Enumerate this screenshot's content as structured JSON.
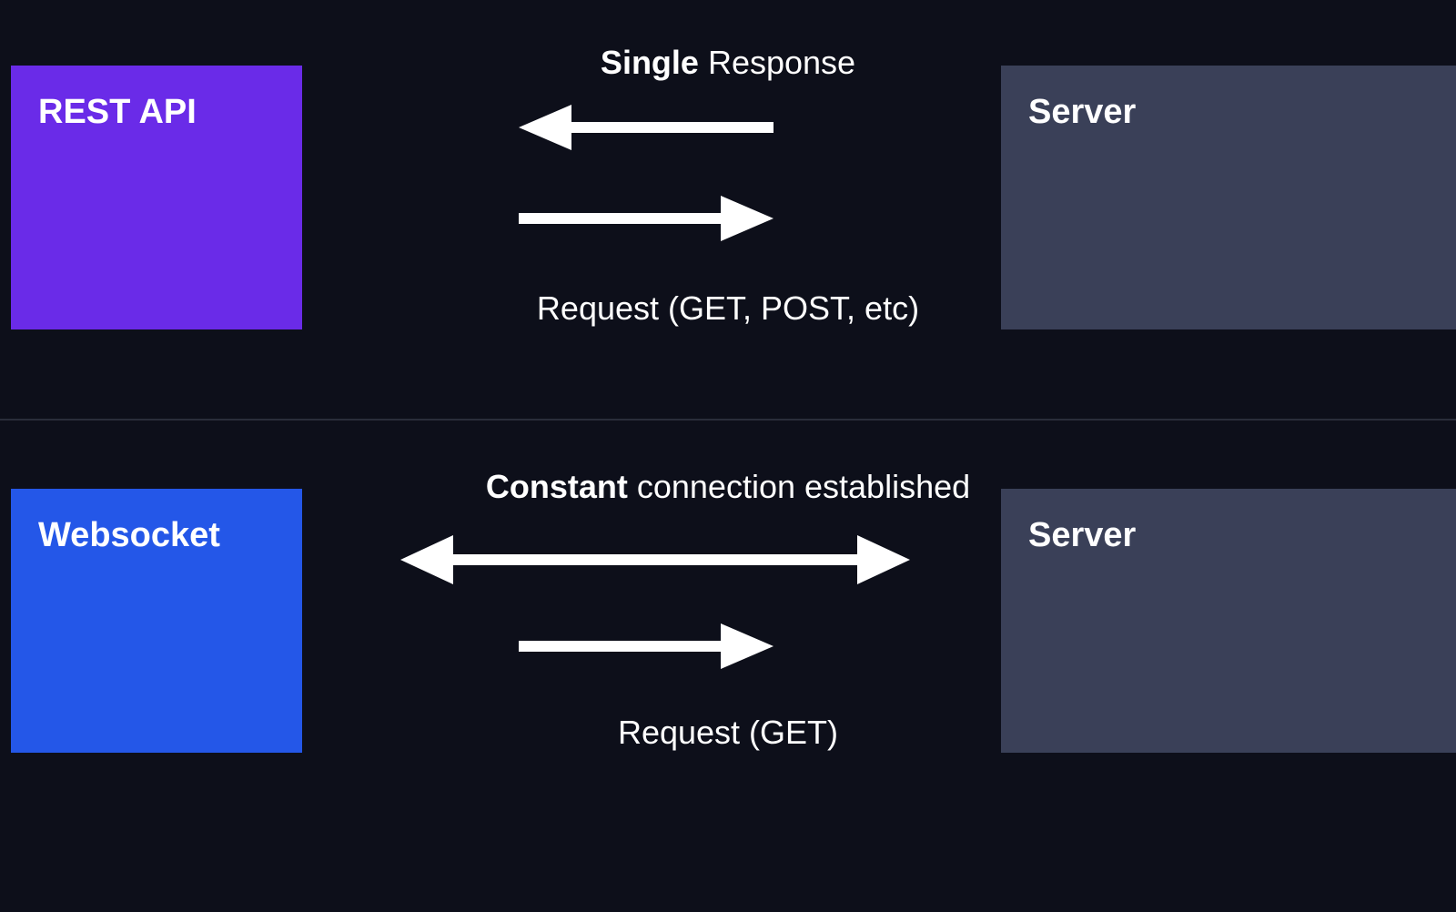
{
  "top": {
    "leftBox": "REST API",
    "rightBox": "Server",
    "topLabelBold": "Single",
    "topLabelRest": " Response",
    "bottomLabel": "Request (GET, POST, etc)"
  },
  "bottom": {
    "leftBox": "Websocket",
    "rightBox": "Server",
    "topLabelBold": "Constant",
    "topLabelRest": " connection established",
    "bottomLabel": "Request (GET)"
  }
}
